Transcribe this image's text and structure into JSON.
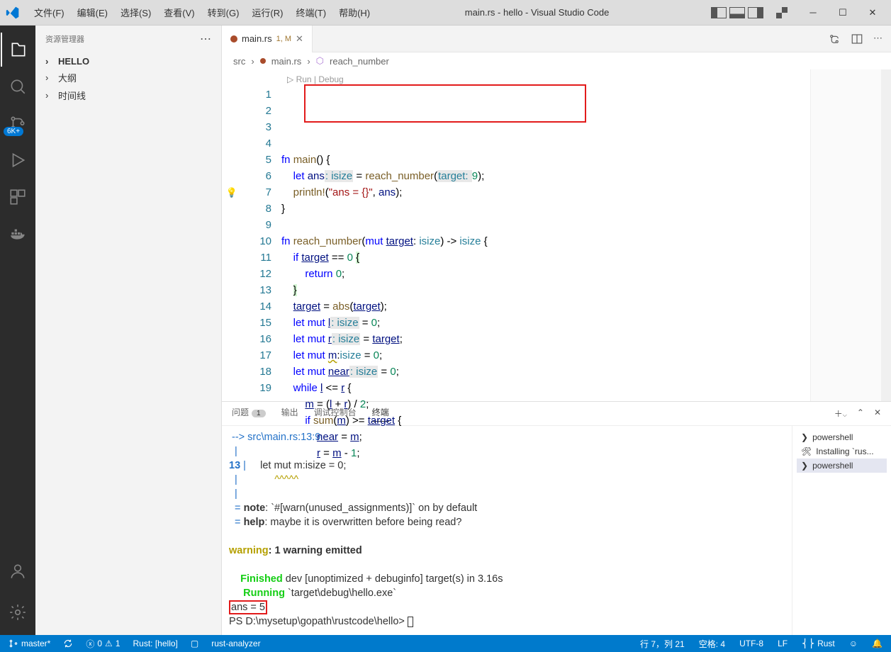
{
  "title": "main.rs - hello - Visual Studio Code",
  "menu": [
    "文件(F)",
    "编辑(E)",
    "选择(S)",
    "查看(V)",
    "转到(G)",
    "运行(R)",
    "终端(T)",
    "帮助(H)"
  ],
  "activity_badge": "6K+",
  "sidebar": {
    "title": "资源管理器",
    "items": [
      {
        "label": "HELLO",
        "bold": true
      },
      {
        "label": "大纲",
        "bold": false
      },
      {
        "label": "时间线",
        "bold": false
      }
    ]
  },
  "tab": {
    "name": "main.rs",
    "mod": "1, M"
  },
  "breadcrumbs": {
    "a": "src",
    "b": "main.rs",
    "c": "reach_number"
  },
  "codelens": "Run | Debug",
  "gutter": [
    "1",
    "2",
    "3",
    "4",
    "5",
    "6",
    "7",
    "8",
    "9",
    "10",
    "11",
    "12",
    "13",
    "14",
    "15",
    "16",
    "17",
    "18",
    "19"
  ],
  "panel": {
    "tabs": {
      "problems": "问题",
      "output": "输出",
      "debug": "调试控制台",
      "terminal": "终端"
    },
    "problem_count": "1",
    "terminals": [
      {
        "label": "powershell"
      },
      {
        "label": "Installing `rus..."
      },
      {
        "label": "powershell"
      }
    ]
  },
  "terminal": {
    "l1": " --> src\\main.rs:13:9",
    "l2_pipe": "  |",
    "l3a": "13 ",
    "l3b": "|",
    "l3c": "     let mut m:isize = 0;",
    "l4": "  |",
    "l4w": "             ^^^^^",
    "l5": "  |",
    "l6a": "  = ",
    "l6b": "note",
    "l6c": ": `#[warn(unused_assignments)]` on by default",
    "l7a": "  = ",
    "l7b": "help",
    "l7c": ": maybe it is overwritten before being read?",
    "l8a": "warning",
    "l8b": ": 1 warning emitted",
    "l9a": "    Finished",
    "l9b": " dev [unoptimized + debuginfo] target(s) in 3.16s",
    "l10a": "     Running",
    "l10b": " `target\\debug\\hello.exe`",
    "l11": "ans = 5",
    "l12": "PS D:\\mysetup\\gopath\\rustcode\\hello> "
  },
  "status": {
    "branch": "master*",
    "errors": "0",
    "warnings": "1",
    "rust": "Rust: [hello]",
    "analyzer": "rust-analyzer",
    "pos": "行 7，列 21",
    "spaces": "空格: 4",
    "enc": "UTF-8",
    "eol": "LF",
    "lang": "Rust"
  }
}
